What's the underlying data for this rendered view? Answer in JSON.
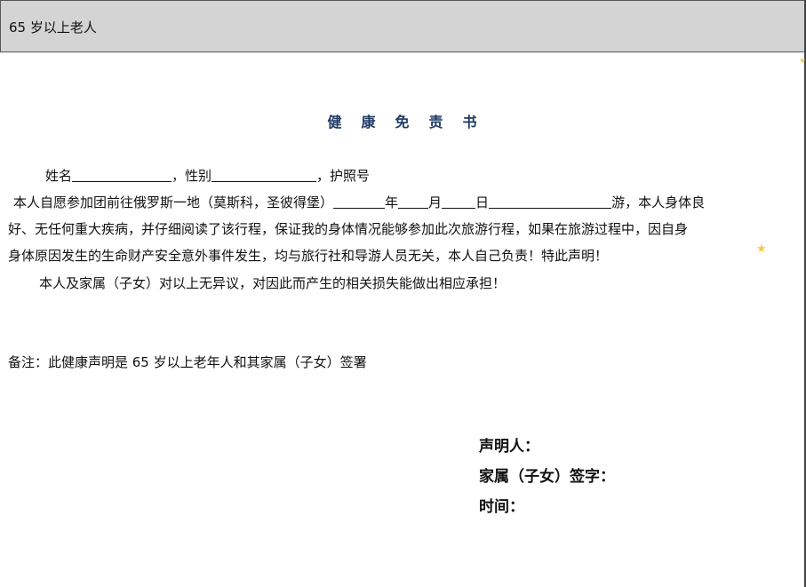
{
  "header": {
    "title": "65 岁以上老人"
  },
  "document": {
    "heading": "健康免责书",
    "line1": {
      "name_label": "姓名",
      "sex_label": "，性别",
      "passport_label": "，护照号"
    },
    "line2": {
      "text_a": "本人自愿参加团前往俄罗斯一地（莫斯科，圣彼得堡）",
      "year": "年",
      "month": "月",
      "day": "日",
      "text_b": "游，本人身体良"
    },
    "line3": "好、无任何重大疾病，并仔细阅读了该行程，保证我的身体情况能够参加此次旅游行程，如果在旅游过程中，因自身",
    "line4": "身体原因发生的生命财产安全意外事件发生，均与旅行社和导游人员无关，本人自己负责！特此声明！",
    "line5": "本人及家属（子女）对以上无异议，对因此而产生的相关损失能做出相应承担！",
    "note": "备注：此健康声明是 65 岁以上老年人和其家属（子女）签署",
    "signatures": {
      "declarant": "声明人：",
      "family": "家属（子女）签字：",
      "time": "时间："
    }
  },
  "colors": {
    "heading": "#1f3a63",
    "header_bg": "#d4d4d4",
    "star": "#f2c94c"
  },
  "decorations": {
    "star_glyph": "★"
  }
}
